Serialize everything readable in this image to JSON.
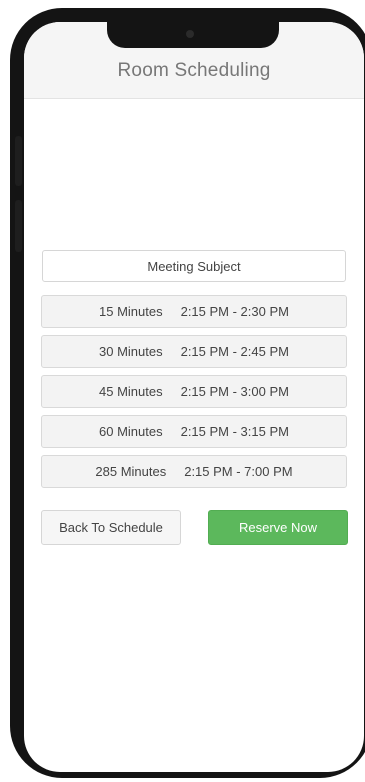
{
  "header": {
    "title": "Room Scheduling"
  },
  "form": {
    "subject_placeholder": "Meeting Subject"
  },
  "options": [
    {
      "duration": "15 Minutes",
      "range": "2:15 PM - 2:30 PM"
    },
    {
      "duration": "30 Minutes",
      "range": "2:15 PM - 2:45 PM"
    },
    {
      "duration": "45 Minutes",
      "range": "2:15 PM - 3:00 PM"
    },
    {
      "duration": "60 Minutes",
      "range": "2:15 PM - 3:15 PM"
    },
    {
      "duration": "285 Minutes",
      "range": "2:15 PM - 7:00 PM"
    }
  ],
  "actions": {
    "back_label": "Back To Schedule",
    "reserve_label": "Reserve Now"
  },
  "colors": {
    "accent": "#5cb85c",
    "header_bg": "#f5f5f5",
    "phone_frame": "#141414"
  }
}
